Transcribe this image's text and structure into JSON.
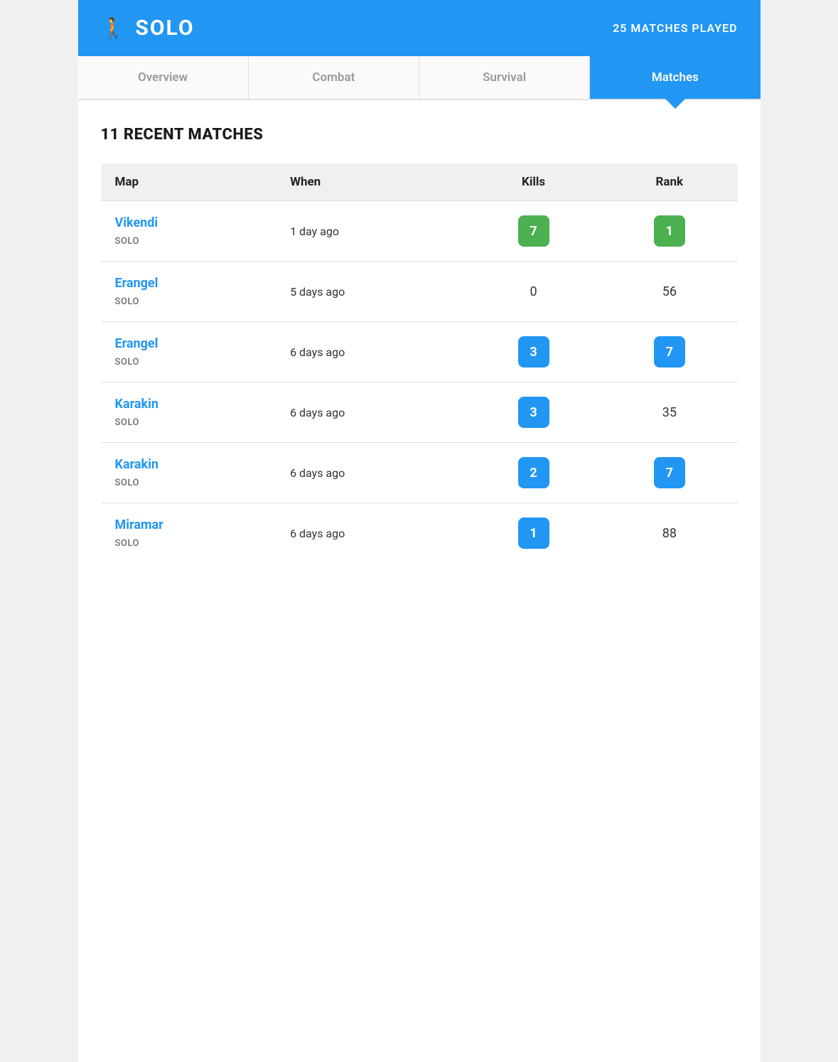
{
  "header": {
    "icon": "🚶",
    "title": "SOLO",
    "matches_played": "25 MATCHES PLAYED"
  },
  "tabs": [
    {
      "id": "overview",
      "label": "Overview",
      "active": false
    },
    {
      "id": "combat",
      "label": "Combat",
      "active": false
    },
    {
      "id": "survival",
      "label": "Survival",
      "active": false
    },
    {
      "id": "matches",
      "label": "Matches",
      "active": true
    }
  ],
  "section": {
    "title": "11 RECENT MATCHES"
  },
  "table": {
    "columns": {
      "map": "Map",
      "when": "When",
      "kills": "Kills",
      "rank": "Rank"
    },
    "rows": [
      {
        "map": "Vikendi",
        "mode": "SOLO",
        "when": "1 day ago",
        "kills": "7",
        "kills_badge": "green",
        "rank": "1",
        "rank_badge": "green"
      },
      {
        "map": "Erangel",
        "mode": "SOLO",
        "when": "5 days ago",
        "kills": "0",
        "kills_badge": "none",
        "rank": "56",
        "rank_badge": "none"
      },
      {
        "map": "Erangel",
        "mode": "SOLO",
        "when": "6 days ago",
        "kills": "3",
        "kills_badge": "blue",
        "rank": "7",
        "rank_badge": "blue"
      },
      {
        "map": "Karakin",
        "mode": "SOLO",
        "when": "6 days ago",
        "kills": "3",
        "kills_badge": "blue",
        "rank": "35",
        "rank_badge": "none"
      },
      {
        "map": "Karakin",
        "mode": "SOLO",
        "when": "6 days ago",
        "kills": "2",
        "kills_badge": "blue",
        "rank": "7",
        "rank_badge": "blue"
      },
      {
        "map": "Miramar",
        "mode": "SOLO",
        "when": "6 days ago",
        "kills": "1",
        "kills_badge": "blue",
        "rank": "88",
        "rank_badge": "none"
      }
    ]
  }
}
